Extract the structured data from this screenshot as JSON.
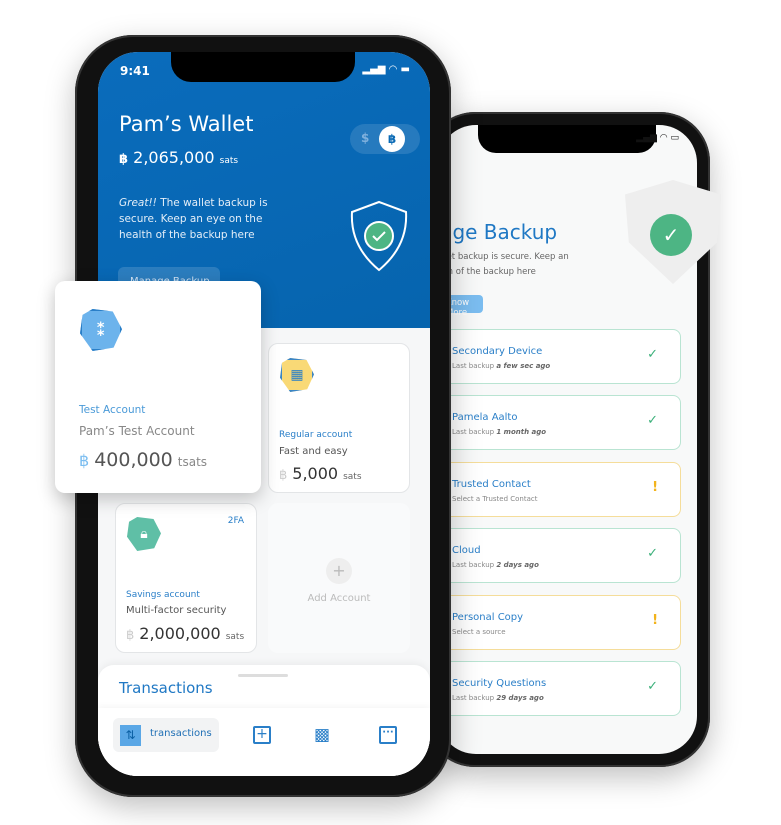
{
  "right_phone": {
    "status": {
      "wifi": "wifi-icon",
      "battery": "battery-icon"
    },
    "title": "Manage Backup",
    "description": "Great!! The wallet backup is secure. Keep an eye on the health of the backup here",
    "know_more": "Know More",
    "items": [
      {
        "title": "Secondary Device",
        "prefix": "Last backup",
        "when": "a few sec ago",
        "status": "ok"
      },
      {
        "title": "Pamela Aalto",
        "prefix": "Last backup",
        "when": "1 month ago",
        "status": "ok"
      },
      {
        "title": "Trusted Contact",
        "prefix": "Select a Trusted Contact",
        "when": "",
        "status": "warning"
      },
      {
        "title": "Cloud",
        "prefix": "Last backup",
        "when": "2 days ago",
        "status": "ok"
      },
      {
        "title": "Personal Copy",
        "prefix": "Select a source",
        "when": "",
        "status": "warning"
      },
      {
        "title": "Security Questions",
        "prefix": "Last backup",
        "when": "29 days ago",
        "status": "ok"
      }
    ],
    "ok_mark": "✓",
    "warn_mark": "!"
  },
  "left_phone": {
    "time": "9:41",
    "wallet_name": "Pam’s Wallet",
    "balance": "2,065,000",
    "balance_unit": "sats",
    "btc_symbol": "฿",
    "toggle": {
      "usd": "$",
      "btc": "฿",
      "selected": "btc"
    },
    "backup_msg_em": "Great!!",
    "backup_msg": " The wallet backup is secure. Keep an eye on the health of the backup here",
    "manage_backup": "Manage Backup",
    "accounts": [
      {
        "type": "Test Account",
        "name": "Pam’s Test Account",
        "amount": "400,000",
        "unit": "tsats"
      },
      {
        "type": "Regular account",
        "name": "Fast and easy",
        "amount": "5,000",
        "unit": "sats"
      },
      {
        "type": "Savings account",
        "name": "Multi-factor security",
        "amount": "2,000,000",
        "unit": "sats",
        "badge": "2FA"
      }
    ],
    "add_account": "Add Account",
    "transactions_title": "Transactions",
    "nav": {
      "transactions": "transactions"
    },
    "colors": {
      "brand": "#0a6ab5",
      "ok": "#3bb07a",
      "warn": "#f2b31c"
    }
  }
}
